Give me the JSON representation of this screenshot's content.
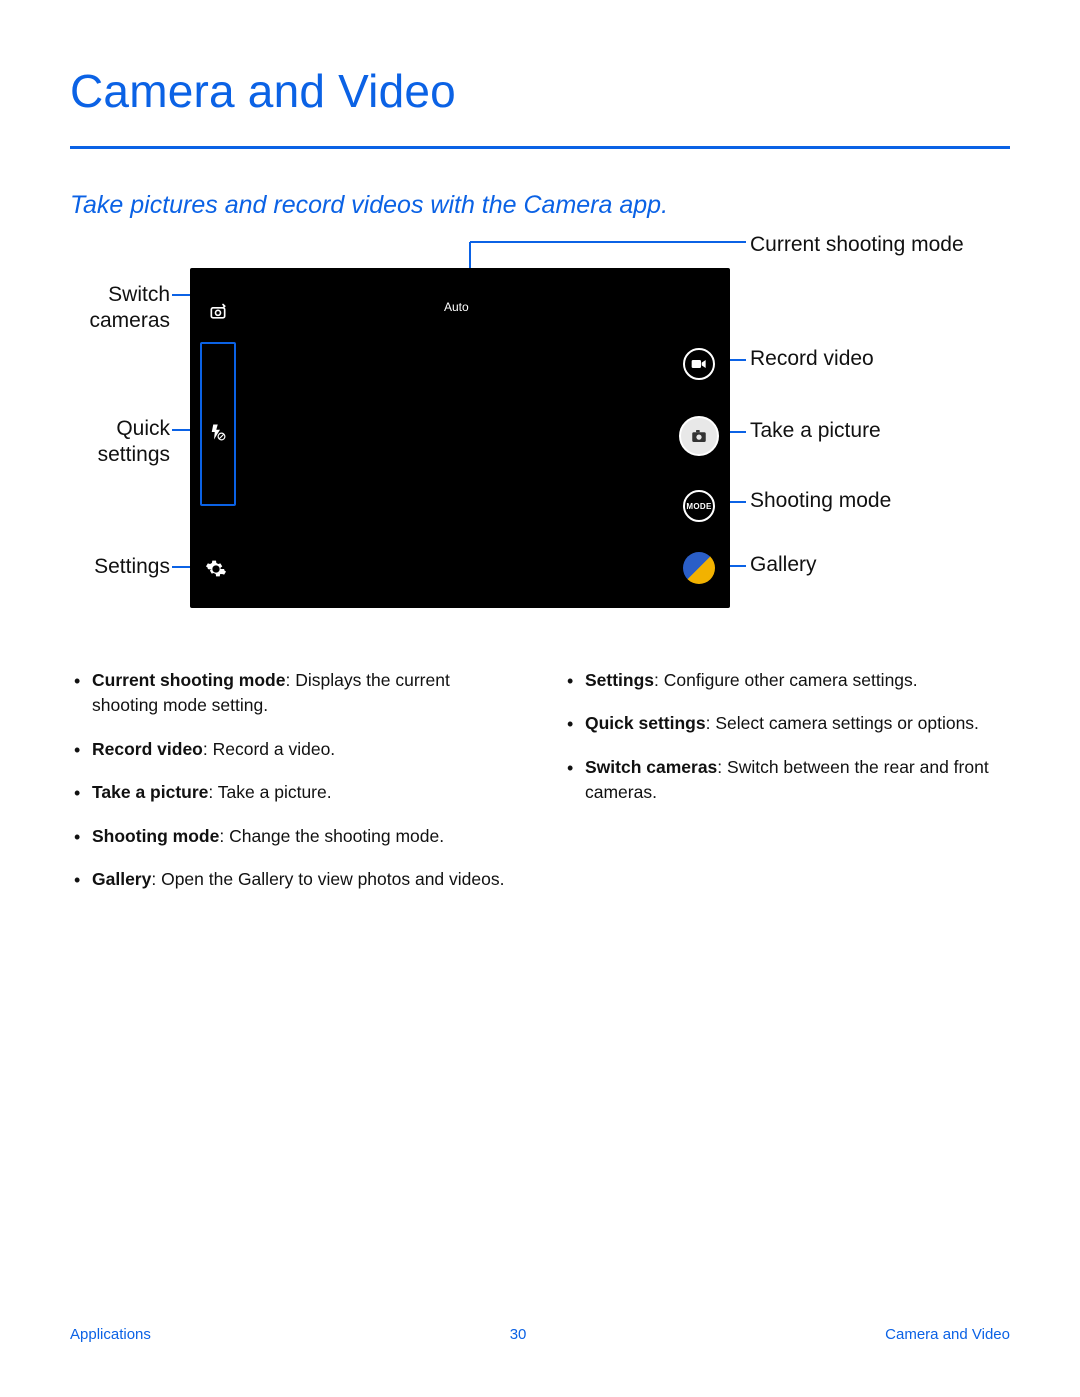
{
  "title": "Camera and Video",
  "subtitle": "Take pictures and record videos with the Camera app.",
  "viewfinder": {
    "mode_label": "Auto",
    "mode_btn_text": "MODE"
  },
  "callouts": {
    "current": "Current shooting mode",
    "record": "Record video",
    "take": "Take a picture",
    "shoot": "Shooting mode",
    "gallery": "Gallery",
    "switch": "Switch cameras",
    "quick": "Quick settings",
    "settings": "Settings"
  },
  "bullets": {
    "left": [
      {
        "term": "Current shooting mode",
        "desc": ": Displays the current shooting mode setting."
      },
      {
        "term": "Record video",
        "desc": ": Record a video."
      },
      {
        "term": "Take a picture",
        "desc": ": Take a picture."
      },
      {
        "term": "Shooting mode",
        "desc": ": Change the shooting mode."
      },
      {
        "term": "Gallery",
        "desc": ": Open the Gallery to view photos and videos."
      }
    ],
    "right": [
      {
        "term": "Settings",
        "desc": ": Configure other camera settings."
      },
      {
        "term": "Quick settings",
        "desc": ": Select camera settings or options."
      },
      {
        "term": "Switch cameras",
        "desc": ": Switch between the rear and front cameras."
      }
    ]
  },
  "footer": {
    "left": "Applications",
    "center": "30",
    "right": "Camera and Video"
  }
}
